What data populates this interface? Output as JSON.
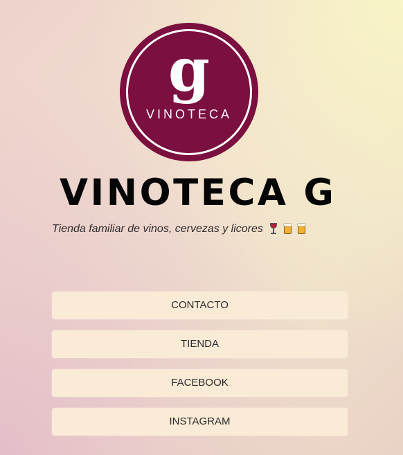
{
  "logo": {
    "letter": "g",
    "wordmark": "VINOTECA",
    "background_color": "#7b0f3f"
  },
  "profile": {
    "title": "VINOTECA G",
    "tagline": "Tienda familiar de vinos, cervezas y licores",
    "tagline_emojis": [
      "wine-glass-emoji",
      "beer-mug-emoji",
      "beer-mug-emoji"
    ]
  },
  "links": [
    {
      "label": "CONTACTO"
    },
    {
      "label": "TIENDA"
    },
    {
      "label": "FACEBOOK"
    },
    {
      "label": "INSTAGRAM"
    }
  ],
  "colors": {
    "button_background": "#faebd7",
    "title_color": "#050505"
  }
}
